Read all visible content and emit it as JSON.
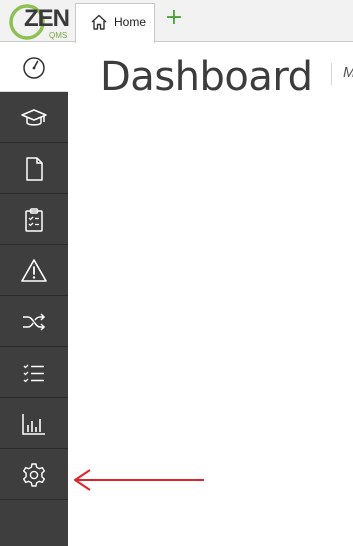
{
  "brand": {
    "logo_text": "ZEN",
    "logo_sub": "QMS"
  },
  "tabs": [
    {
      "label": "Home",
      "icon": "home-icon",
      "active": true
    }
  ],
  "add_tab_label": "+",
  "sidebar": {
    "items": [
      {
        "name": "dashboard",
        "icon": "gauge-icon",
        "active": true
      },
      {
        "name": "training",
        "icon": "graduation-cap-icon"
      },
      {
        "name": "documents",
        "icon": "document-icon"
      },
      {
        "name": "audits",
        "icon": "clipboard-checklist-icon"
      },
      {
        "name": "risks",
        "icon": "warning-icon"
      },
      {
        "name": "processes",
        "icon": "shuffle-icon"
      },
      {
        "name": "checklists",
        "icon": "checklist-icon"
      },
      {
        "name": "reports",
        "icon": "bar-chart-icon"
      },
      {
        "name": "settings",
        "icon": "gear-icon"
      }
    ]
  },
  "main": {
    "title": "Dashboard",
    "cut_text": "M"
  },
  "annotation": {
    "arrow_color": "#e0242a",
    "points_to": "settings"
  },
  "colors": {
    "sidebar_bg": "#3e3e3e",
    "accent_green": "#4aa13c",
    "logo_ring": "#8cc152"
  }
}
